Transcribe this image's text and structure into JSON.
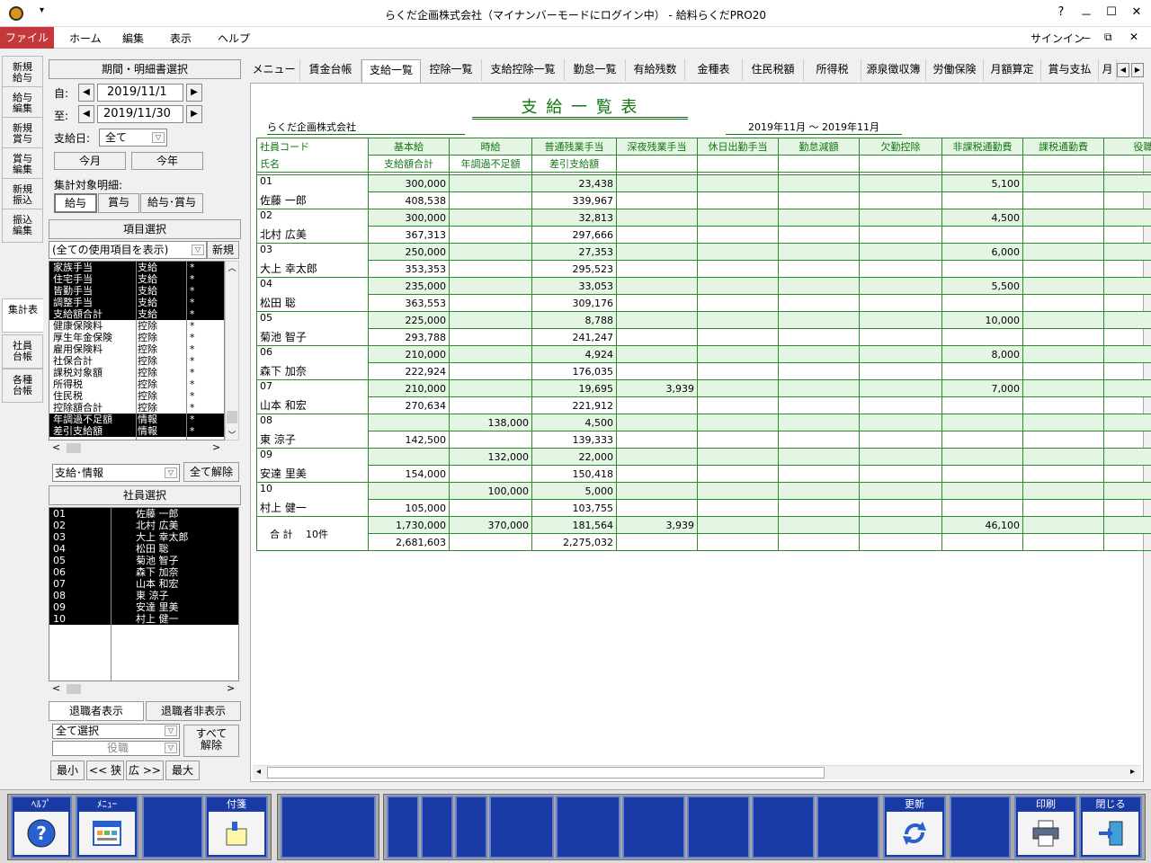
{
  "window": {
    "title": "らくだ企画株式会社（マイナンバーモードにログイン中） - 給料らくだPRO20",
    "qa": "▾",
    "minimize": "－",
    "maximize": "☐",
    "close": "✕"
  },
  "menubar": {
    "items": [
      "ファイル",
      "ホーム",
      "編集",
      "表示",
      "ヘルプ"
    ],
    "signin": "サインイン",
    "min": "－",
    "restore": "⧉",
    "close": "✕"
  },
  "lefttabs": [
    "新規\n給与",
    "給与\n編集",
    "新規\n賞与",
    "賞与\n編集",
    "新規\n振込",
    "振込\n編集",
    "集計表",
    "社員\n台帳",
    "各種\n台帳"
  ],
  "period": {
    "header": "期間・明細書選択",
    "from_label": "自:",
    "from": "2019/11/1",
    "to_label": "至:",
    "to": "2019/11/30",
    "payday_label": "支給日:",
    "payday": "全て",
    "month_btn": "今月",
    "year_btn": "今年",
    "target_label": "集計対象明細:",
    "targets": [
      "給与",
      "賞与",
      "給与･賞与"
    ]
  },
  "items": {
    "header": "項目選択",
    "filter": "(全ての使用項目を表示)",
    "new_btn": "新規",
    "rows": [
      [
        "家族手当",
        "支給",
        "*",
        1
      ],
      [
        "住宅手当",
        "支給",
        "*",
        1
      ],
      [
        "皆勤手当",
        "支給",
        "*",
        1
      ],
      [
        "調整手当",
        "支給",
        "*",
        1
      ],
      [
        "支給額合計",
        "支給",
        "*",
        1
      ],
      [
        "健康保険料",
        "控除",
        "*",
        0
      ],
      [
        "厚生年金保険",
        "控除",
        "*",
        0
      ],
      [
        "雇用保険料",
        "控除",
        "*",
        0
      ],
      [
        "社保合計",
        "控除",
        "*",
        0
      ],
      [
        "課税対象額",
        "控除",
        "*",
        0
      ],
      [
        "所得税",
        "控除",
        "*",
        0
      ],
      [
        "住民税",
        "控除",
        "*",
        0
      ],
      [
        "控除額合計",
        "控除",
        "*",
        0
      ],
      [
        "年調過不足額",
        "情報",
        "*",
        1
      ],
      [
        "差引支給額",
        "情報",
        "*",
        1
      ]
    ],
    "type_filter": "支給･情報",
    "clear_btn": "全て解除"
  },
  "employees": {
    "header": "社員選択",
    "rows": [
      [
        "01",
        "佐藤 一郎"
      ],
      [
        "02",
        "北村 広美"
      ],
      [
        "03",
        "大上 幸太郎"
      ],
      [
        "04",
        "松田 聡"
      ],
      [
        "05",
        "菊池 智子"
      ],
      [
        "06",
        "森下 加奈"
      ],
      [
        "07",
        "山本 和宏"
      ],
      [
        "08",
        "東 涼子"
      ],
      [
        "09",
        "安達 里美"
      ],
      [
        "10",
        "村上 健一"
      ]
    ],
    "show_retired": "退職者表示",
    "hide_retired": "退職者非表示",
    "select_all": "全て選択",
    "role": "役職",
    "clear_all": "すべて\n解除",
    "min": "最小",
    "narrow": "<< 狭",
    "wide": "広 >>",
    "max": "最大"
  },
  "tabs": [
    "メニュー",
    "賃金台帳",
    "支給一覧",
    "控除一覧",
    "支給控除一覧",
    "勤怠一覧",
    "有給残数",
    "金種表",
    "住民税額",
    "所得税",
    "源泉徴収簿",
    "労働保険",
    "月額算定",
    "賞与支払",
    "月"
  ],
  "report": {
    "title": "支 給 一 覧 表",
    "company": "らくだ企画株式会社",
    "period": "2019年11月 ～ 2019年11月",
    "head1": [
      "社員コード",
      "基本給",
      "時給",
      "普通残業手当",
      "深夜残業手当",
      "休日出勤手当",
      "勤怠減額",
      "欠勤控除",
      "非課税通勤費",
      "課税通勤費",
      "役職"
    ],
    "head2": [
      "氏名",
      "支給額合計",
      "年調過不足額",
      "差引支給額"
    ],
    "rows": [
      {
        "code": "01",
        "name": "佐藤 一郎",
        "r1": [
          "300,000",
          "",
          "23,438",
          "",
          "",
          "",
          "",
          "5,100",
          "",
          ""
        ],
        "r2": [
          "408,538",
          "",
          "339,967"
        ]
      },
      {
        "code": "02",
        "name": "北村 広美",
        "r1": [
          "300,000",
          "",
          "32,813",
          "",
          "",
          "",
          "",
          "4,500",
          "",
          ""
        ],
        "r2": [
          "367,313",
          "",
          "297,666"
        ]
      },
      {
        "code": "03",
        "name": "大上 幸太郎",
        "r1": [
          "250,000",
          "",
          "27,353",
          "",
          "",
          "",
          "",
          "6,000",
          "",
          ""
        ],
        "r2": [
          "353,353",
          "",
          "295,523"
        ]
      },
      {
        "code": "04",
        "name": "松田 聡",
        "r1": [
          "235,000",
          "",
          "33,053",
          "",
          "",
          "",
          "",
          "5,500",
          "",
          ""
        ],
        "r2": [
          "363,553",
          "",
          "309,176"
        ]
      },
      {
        "code": "05",
        "name": "菊池 智子",
        "r1": [
          "225,000",
          "",
          "8,788",
          "",
          "",
          "",
          "",
          "10,000",
          "",
          ""
        ],
        "r2": [
          "293,788",
          "",
          "241,247"
        ]
      },
      {
        "code": "06",
        "name": "森下 加奈",
        "r1": [
          "210,000",
          "",
          "4,924",
          "",
          "",
          "",
          "",
          "8,000",
          "",
          ""
        ],
        "r2": [
          "222,924",
          "",
          "176,035"
        ]
      },
      {
        "code": "07",
        "name": "山本 和宏",
        "r1": [
          "210,000",
          "",
          "19,695",
          "3,939",
          "",
          "",
          "",
          "7,000",
          "",
          ""
        ],
        "r2": [
          "270,634",
          "",
          "221,912"
        ]
      },
      {
        "code": "08",
        "name": "東 涼子",
        "r1": [
          "",
          "138,000",
          "4,500",
          "",
          "",
          "",
          "",
          "",
          "",
          ""
        ],
        "r2": [
          "142,500",
          "",
          "139,333"
        ]
      },
      {
        "code": "09",
        "name": "安達 里美",
        "r1": [
          "",
          "132,000",
          "22,000",
          "",
          "",
          "",
          "",
          "",
          "",
          ""
        ],
        "r2": [
          "154,000",
          "",
          "150,418"
        ]
      },
      {
        "code": "10",
        "name": "村上 健一",
        "r1": [
          "",
          "100,000",
          "5,000",
          "",
          "",
          "",
          "",
          "",
          "",
          ""
        ],
        "r2": [
          "105,000",
          "",
          "103,755"
        ]
      }
    ],
    "total": {
      "label": "合 計　 10件",
      "r1": [
        "1,730,000",
        "370,000",
        "181,564",
        "3,939",
        "",
        "",
        "",
        "46,100",
        "",
        ""
      ],
      "r2": [
        "2,681,603",
        "",
        "2,275,032"
      ]
    }
  },
  "fkeys": [
    {
      "label": "ﾍﾙﾌﾟ",
      "icon": "help-icon"
    },
    {
      "label": "ﾒﾆｭｰ",
      "icon": "menu-icon"
    },
    {
      "label": "付箋",
      "icon": "sticky-note-icon"
    },
    {
      "label": "更新",
      "icon": "refresh-icon"
    },
    {
      "label": "印刷",
      "icon": "printer-icon"
    },
    {
      "label": "閉じる",
      "icon": "exit-icon"
    }
  ]
}
